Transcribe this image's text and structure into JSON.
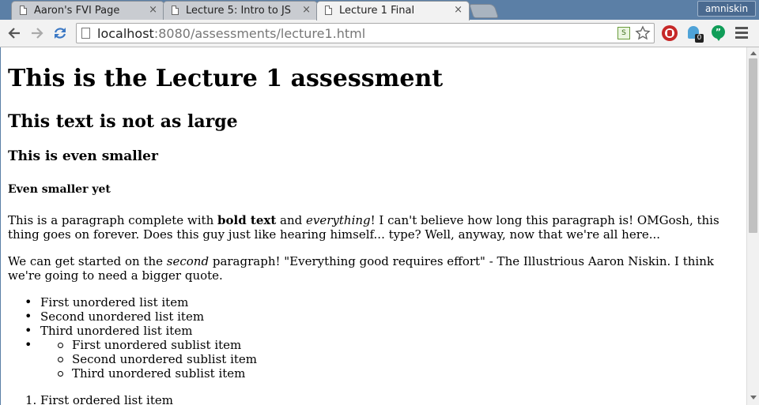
{
  "browser": {
    "tabs": [
      {
        "title": "Aaron's FVI Page",
        "active": false
      },
      {
        "title": "Lecture 5: Intro to JS",
        "active": false
      },
      {
        "title": "Lecture 1 Final",
        "active": true
      }
    ],
    "close_glyph": "×",
    "user": "amniskin",
    "url_host": "localhost",
    "url_rest": ":8080/assessments/lecture1.html",
    "extension_badge_count": "0",
    "reader_label": "S",
    "hangouts_label": "”"
  },
  "page": {
    "h1": "This is the Lecture 1 assessment",
    "h2": "This text is not as large",
    "h3": "This is even smaller",
    "h4": "Even smaller yet",
    "p1": {
      "t1": "This is a paragraph complete with ",
      "bold": "bold text",
      "t2": " and ",
      "italic": "everything",
      "t3": "! I can't believe how long this paragraph is! OMGosh, this thing goes on forever. Does this guy just like hearing himself... type? Well, anyway, now that we're all here..."
    },
    "p2": {
      "t1": "We can get started on the ",
      "italic": "second",
      "t2": " paragraph! \"Everything good requires effort\" - The Illustrious Aaron Niskin. I think we're going to need a bigger quote."
    },
    "unordered": [
      "First unordered list item",
      "Second unordered list item",
      "Third unordered list item"
    ],
    "sublist": [
      "First unordered sublist item",
      "Second unordered sublist item",
      "Third unordered sublist item"
    ],
    "ordered": [
      "First ordered list item"
    ]
  },
  "colors": {
    "tabstrip": "#5b7fa6",
    "toolbar": "#f2f2f2",
    "stop_extension": "#c62828",
    "hangouts": "#109d58"
  },
  "icons": [
    "page-icon",
    "back-arrow-icon",
    "forward-arrow-icon",
    "reload-icon",
    "star-icon",
    "menu-icon"
  ]
}
